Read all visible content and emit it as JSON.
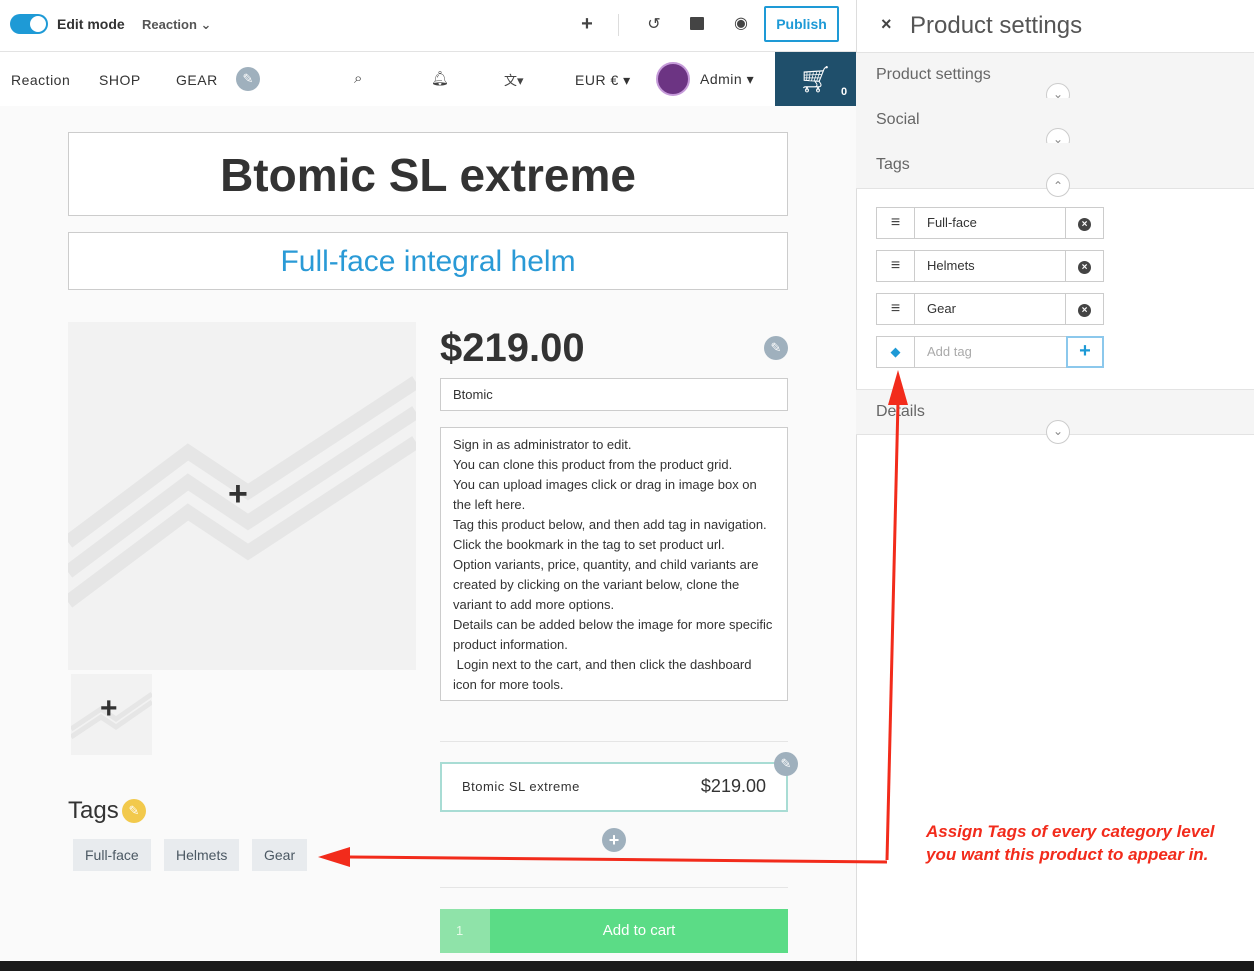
{
  "toolbar": {
    "edit_mode_label": "Edit mode",
    "shop_selector": "Reaction",
    "publish_label": "Publish",
    "icons": [
      "plus-icon",
      "undo-icon",
      "archive-icon",
      "eye-icon"
    ]
  },
  "nav": {
    "items": [
      "Reaction",
      "SHOP",
      "GEAR"
    ],
    "currency": "EUR €",
    "user": "Admin",
    "cart_count": "0"
  },
  "product": {
    "title": "Btomic SL extreme",
    "subtitle": "Full-face integral helm",
    "price": "$219.00",
    "vendor": "Btomic",
    "description": "Sign in as administrator to edit.\nYou can clone this product from the product grid.\nYou can upload images click or drag in image box on the left here.\nTag this product below, and then add tag in navigation.\nClick the bookmark in the tag to set product url.\nOption variants, price, quantity, and child variants are created by clicking on the variant below, clone the variant to add more options.\nDetails can be added below the image for more specific product information.\n Login next to the cart, and then click the dashboard icon for more tools.",
    "variant": {
      "name": "Btomic SL extreme",
      "price": "$219.00"
    },
    "tags_heading": "Tags",
    "tags": [
      "Full-face",
      "Helmets",
      "Gear"
    ],
    "qty": "1",
    "add_to_cart": "Add to cart"
  },
  "panel": {
    "title": "Product settings",
    "sections": [
      "Product settings",
      "Social",
      "Tags",
      "Details"
    ],
    "tag_rows": [
      "Full-face",
      "Helmets",
      "Gear"
    ],
    "add_tag_placeholder": "Add tag"
  },
  "annotation": {
    "line1": "Assign Tags of every category level",
    "line2": "you want this product to appear in."
  },
  "colors": {
    "accent": "#1e9ad6",
    "cart": "#1f4f6b",
    "add_to_cart": "#5bdc86",
    "annotation": "#f22b1b"
  }
}
